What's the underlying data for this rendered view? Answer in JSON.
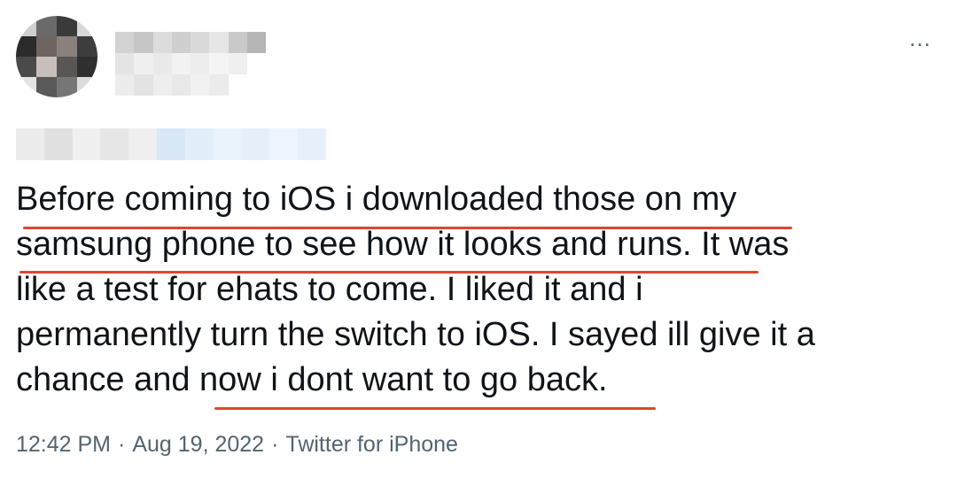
{
  "tweet": {
    "more_icon": "…",
    "lines": [
      "Before coming to iOS i downloaded those on my",
      "samsung phone to see how it looks and runs. It was",
      "like a test for ehats to come. I liked it and i",
      "permanently turn the switch to iOS. I sayed ill give it a",
      "chance and now i dont want to go back."
    ],
    "highlight_color": "#e2452f"
  },
  "meta": {
    "time": "12:42 PM",
    "separator": "·",
    "date": "Aug 19, 2022",
    "source": "Twitter for iPhone"
  }
}
